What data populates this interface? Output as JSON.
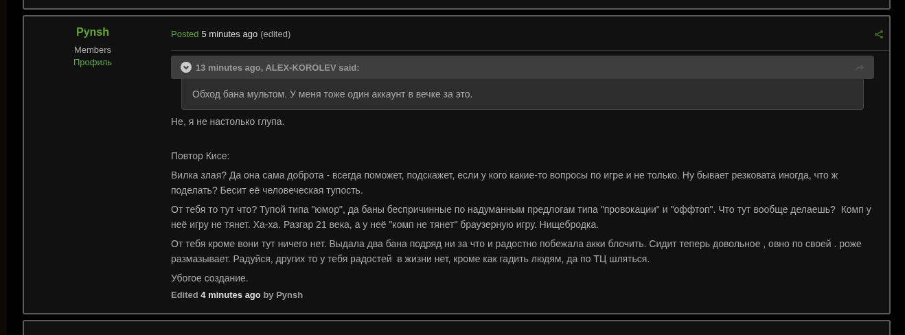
{
  "author": {
    "name": "Pynsh",
    "group": "Members",
    "profile_link": "Профиль"
  },
  "post_header": {
    "posted_label": "Posted",
    "time": "5 minutes ago",
    "edited_tag": "(edited)"
  },
  "quote": {
    "header": "13 minutes ago, ALEX-KOROLEV said:",
    "text": "Обход бана мультом. У меня тоже один аккаунт в вечке за это."
  },
  "paragraphs": [
    {
      "kind": "text",
      "text": "Не, я не настолько глупа."
    },
    {
      "kind": "blank"
    },
    {
      "kind": "text",
      "text": "Повтор Кисе:"
    },
    {
      "kind": "text",
      "text": "Вилка злая? Да она сама доброта - всегда поможет, подскажет, если у кого какие-то вопросы по игре и не только. Ну бывает резковата иногда, что ж поделать? Бесит её человеческая тупость."
    },
    {
      "kind": "text",
      "text": "От тебя то тут что? Тупой типа \"юмор\", да баны беспричинные по надуманным предлогам типа \"провокации\" и \"оффтоп\". Что тут вообще делаешь?  Комп у неё игру не тянет. Ха-ха. Разгар 21 века, а у неё \"комп не тянет\" браузерную игру. Нищебродка."
    },
    {
      "kind": "text",
      "text": "От тебя кроме вони тут ничего нет. Выдала два бана подряд ни за что и радостно побежала акки блочить. Сидит теперь довольное , овно по своей . роже размазывает. Радуйся, других то у тебя радостей  в жизни нет, кроме как гадить людям, да по ТЦ шляться."
    },
    {
      "kind": "text",
      "text": "Убогое создание."
    }
  ],
  "edit_note": "Edited **4 minutes ago** by Pynsh"
}
